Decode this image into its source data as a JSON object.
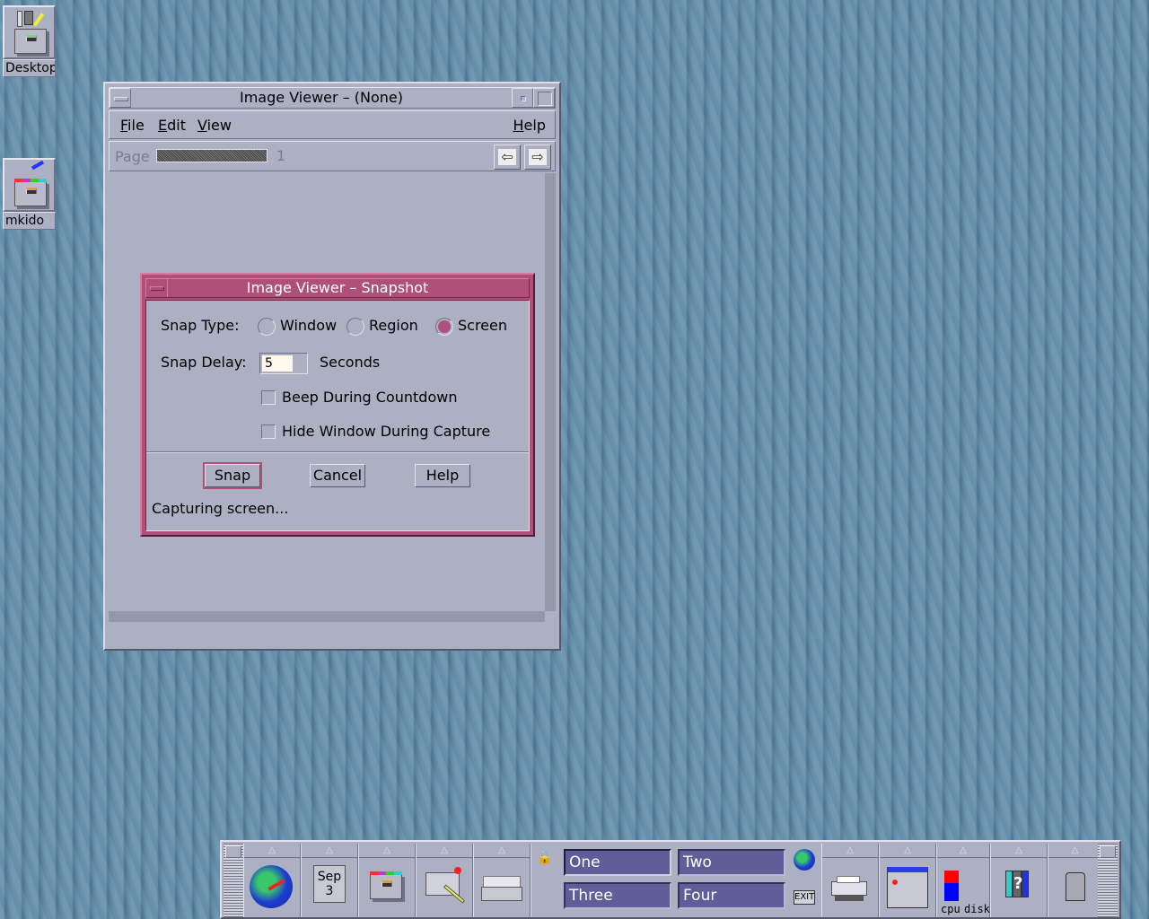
{
  "desktop": {
    "icons": [
      {
        "label": "Desktop",
        "icon": "desktop-folder-icon"
      },
      {
        "label": "mkido",
        "icon": "folder-icon"
      }
    ]
  },
  "image_viewer": {
    "title": "Image Viewer – (None)",
    "menus": [
      {
        "label": "File",
        "mnemonic": "F"
      },
      {
        "label": "Edit",
        "mnemonic": "E"
      },
      {
        "label": "View",
        "mnemonic": "V"
      },
      {
        "label": "Help",
        "mnemonic": "H"
      }
    ],
    "page_label": "Page",
    "page_value": "1",
    "prev_icon": "⇦",
    "next_icon": "⇨"
  },
  "snapshot_dialog": {
    "title": "Image Viewer – Snapshot",
    "snap_type_label": "Snap Type:",
    "snap_types": [
      {
        "label": "Window",
        "selected": false
      },
      {
        "label": "Region",
        "selected": false
      },
      {
        "label": "Screen",
        "selected": true
      }
    ],
    "snap_delay_label": "Snap Delay:",
    "snap_delay_value": "5",
    "snap_delay_unit": "Seconds",
    "options": [
      {
        "label": "Beep During Countdown",
        "checked": false
      },
      {
        "label": "Hide Window During Capture",
        "checked": false
      }
    ],
    "buttons": {
      "snap": "Snap",
      "cancel": "Cancel",
      "help": "Help"
    },
    "status": "Capturing screen...",
    "accent_color": "#b05078"
  },
  "front_panel": {
    "calendar": {
      "month": "Sep",
      "day": "3"
    },
    "workspaces": [
      {
        "label": "One",
        "active": true
      },
      {
        "label": "Two",
        "active": false
      },
      {
        "label": "Three",
        "active": false
      },
      {
        "label": "Four",
        "active": false
      }
    ],
    "exit_label": "EXIT",
    "meter_labels": {
      "cpu": "cpu",
      "disk": "disk"
    },
    "subpanel_arrow": "△"
  }
}
